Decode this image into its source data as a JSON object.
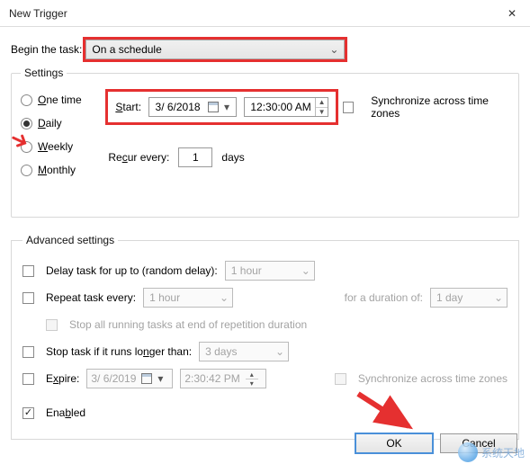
{
  "window": {
    "title": "New Trigger",
    "close_icon": "✕"
  },
  "begin": {
    "label": "Begin the task:",
    "value": "On a schedule"
  },
  "settings": {
    "legend": "Settings",
    "radios": {
      "one_time": "One time",
      "daily": "Daily",
      "weekly": "Weekly",
      "monthly": "Monthly",
      "selected": "daily"
    },
    "start_label": "Start:",
    "date": "3/ 6/2018",
    "time": "12:30:00 AM",
    "sync_label": "Synchronize across time zones",
    "recur_label": "Recur every:",
    "recur_value": "1",
    "recur_unit": "days"
  },
  "advanced": {
    "legend": "Advanced settings",
    "delay_label": "Delay task for up to (random delay):",
    "delay_value": "1 hour",
    "repeat_label": "Repeat task every:",
    "repeat_value": "1 hour",
    "duration_label": "for a duration of:",
    "duration_value": "1 day",
    "stop_all_label": "Stop all running tasks at end of repetition duration",
    "stop_longer_label": "Stop task if it runs longer than:",
    "stop_longer_value": "3 days",
    "expire_label": "Expire:",
    "expire_date": "3/ 6/2019",
    "expire_time": "2:30:42 PM",
    "sync_label": "Synchronize across time zones",
    "enabled_label": "Enabled"
  },
  "actions": {
    "ok": "OK",
    "cancel": "Cancel"
  },
  "watermark": {
    "text": "系统天地"
  }
}
